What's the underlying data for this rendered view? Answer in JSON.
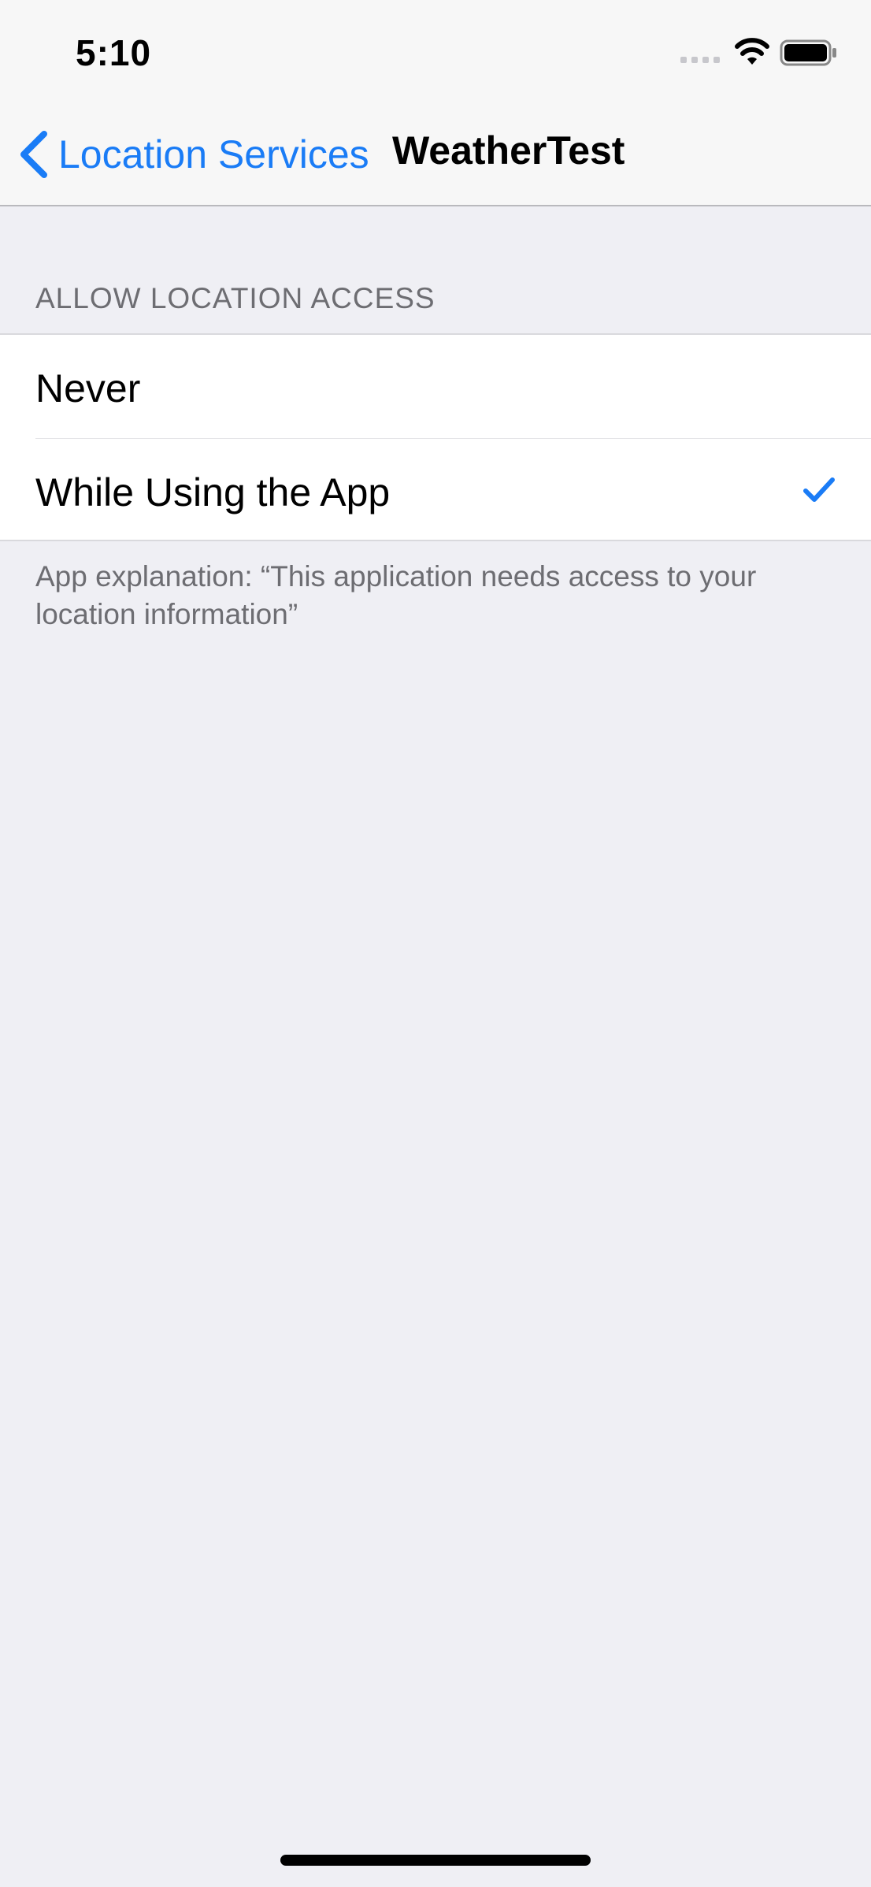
{
  "status_bar": {
    "time": "5:10",
    "icons": [
      "cellular-signal-icon",
      "wifi-icon",
      "battery-icon"
    ]
  },
  "nav": {
    "back_label": "Location Services",
    "title": "WeatherTest"
  },
  "section": {
    "header": "ALLOW LOCATION ACCESS",
    "options": [
      {
        "label": "Never",
        "selected": false
      },
      {
        "label": "While Using the App",
        "selected": true
      }
    ],
    "footer": "App explanation: “This application needs access to your location information”"
  },
  "colors": {
    "accent": "#1a7cf6",
    "background": "#efeff4",
    "secondary_text": "#6d6d72"
  }
}
